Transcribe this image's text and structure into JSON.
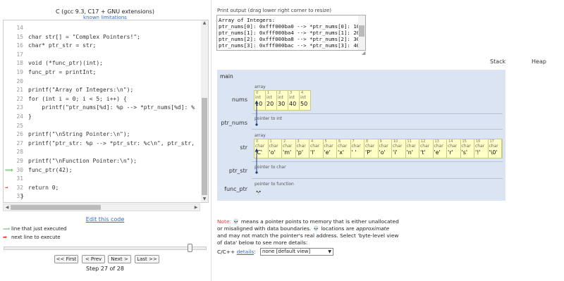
{
  "header": {
    "language": "C (gcc 9.3, C17 + GNU extensions)",
    "known_limitations": "known limitations"
  },
  "code": [
    {
      "n": "14",
      "text": "",
      "arrow": ""
    },
    {
      "n": "15",
      "text": "char str[] = \"Complex Pointers!\";",
      "arrow": ""
    },
    {
      "n": "16",
      "text": "char* ptr_str = str;",
      "arrow": ""
    },
    {
      "n": "17",
      "text": "",
      "arrow": ""
    },
    {
      "n": "18",
      "text": "void (*func_ptr)(int);",
      "arrow": ""
    },
    {
      "n": "19",
      "text": "func_ptr = printInt;",
      "arrow": ""
    },
    {
      "n": "20",
      "text": "",
      "arrow": ""
    },
    {
      "n": "21",
      "text": "printf(\"Array of Integers:\\n\");",
      "arrow": ""
    },
    {
      "n": "22",
      "text": "for (int i = 0; i < 5; i++) {",
      "arrow": ""
    },
    {
      "n": "23",
      "text": "    printf(\"ptr_nums[%d]: %p --> *ptr_nums[%d]: %",
      "arrow": ""
    },
    {
      "n": "24",
      "text": "}",
      "arrow": ""
    },
    {
      "n": "25",
      "text": "",
      "arrow": ""
    },
    {
      "n": "26",
      "text": "printf(\"\\nString Pointer:\\n\");",
      "arrow": ""
    },
    {
      "n": "27",
      "text": "printf(\"ptr_str: %p --> *ptr_str: %c\\n\", ptr_str,",
      "arrow": ""
    },
    {
      "n": "28",
      "text": "",
      "arrow": ""
    },
    {
      "n": "29",
      "text": "printf(\"\\nFunction Pointer:\\n\");",
      "arrow": ""
    },
    {
      "n": "30",
      "text": "func_ptr(42);",
      "arrow": "green"
    },
    {
      "n": "31",
      "text": "",
      "arrow": ""
    },
    {
      "n": "32",
      "text": "return 0;",
      "arrow": "red"
    },
    {
      "n": "33",
      "text": "}",
      "arrow": ""
    }
  ],
  "edit_code": "Edit this code",
  "legend": {
    "green": "line that just executed",
    "red": "next line to execute",
    "green_glyph": "⟹",
    "red_glyph": "➡"
  },
  "nav": {
    "first": "<< First",
    "prev": "< Prev",
    "next": "Next >",
    "last": "Last >>",
    "step": "Step 27 of 28",
    "slider_position": 0.93
  },
  "output": {
    "label": "Print output (drag lower right corner to resize)",
    "lines": [
      "Array of Integers:",
      "ptr_nums[0]: 0xfff000ba0 --> *ptr_nums[0]: 10",
      "ptr_nums[1]: 0xfff000ba4 --> *ptr_nums[1]: 20",
      "ptr_nums[2]: 0xfff000ba8 --> *ptr_nums[2]: 30",
      "ptr_nums[3]: 0xfff000bac --> *ptr_nums[3]: 40"
    ]
  },
  "viz": {
    "stack": "Stack",
    "heap": "Heap",
    "frame": "main",
    "nums": {
      "name": "nums",
      "label": "array",
      "type": "int",
      "values": [
        "10",
        "20",
        "30",
        "40",
        "50"
      ]
    },
    "ptr_nums": {
      "name": "ptr_nums",
      "label": "pointer to int"
    },
    "str": {
      "name": "str",
      "label": "array",
      "type": "char",
      "values": [
        "'C'",
        "'o'",
        "'m'",
        "'p'",
        "'l'",
        "'e'",
        "'x'",
        "' '",
        "'P'",
        "'o'",
        "'i'",
        "'n'",
        "'t'",
        "'e'",
        "'r'",
        "'s'",
        "'!'",
        "'\\0'"
      ]
    },
    "ptr_str": {
      "name": "ptr_str",
      "label": "pointer to char"
    },
    "func_ptr": {
      "name": "func_ptr",
      "label": "pointer to function"
    },
    "skull": "💀"
  },
  "note": {
    "label": "Note:",
    "text_1": "means a pointer points to memory that is either unallocated or misaligned with data boundaries.",
    "text_2": "locations are",
    "approx": "approximate",
    "text_3": "and may not match the pointer's real address. Select 'byte-level view of data' below to see more details:"
  },
  "details": {
    "prefix": "C/C++",
    "link": "details",
    "select_value": "none [default view]"
  },
  "colors": {
    "frame_bg": "#dbe4f3",
    "cell_bg": "#ffffc6",
    "link": "#3366cc",
    "green_arrow": "#70c070",
    "red_arrow": "#e0302a"
  }
}
